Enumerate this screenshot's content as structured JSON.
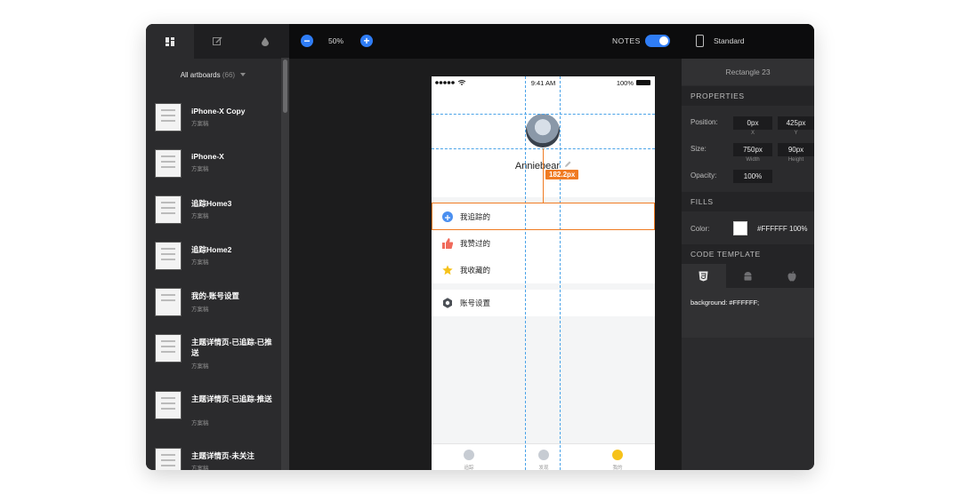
{
  "sidebar": {
    "tabs": [
      {
        "icon": "artboards-grid-icon",
        "active": true
      },
      {
        "icon": "edit-slice-icon",
        "active": false
      },
      {
        "icon": "color-drop-icon",
        "active": false
      }
    ],
    "filter_label": "All artboards",
    "filter_count": "(66)",
    "artboards": [
      {
        "name": "iPhone-X Copy",
        "sub": "方案稿"
      },
      {
        "name": "iPhone-X",
        "sub": "方案稿"
      },
      {
        "name": "追踪Home3",
        "sub": "方案稿"
      },
      {
        "name": "追踪Home2",
        "sub": "方案稿"
      },
      {
        "name": "我的-账号设置",
        "sub": "方案稿"
      },
      {
        "name": "主题详情页-已追踪-已推送",
        "sub": "方案稿"
      },
      {
        "name": "主题详情页-已追踪-推送",
        "sub": "方案稿"
      },
      {
        "name": "主题详情页-未关注",
        "sub": "方案稿"
      }
    ]
  },
  "toolbar": {
    "zoom_out": "−",
    "zoom_value": "50%",
    "zoom_in": "+",
    "notes_label": "NOTES",
    "notes_on": true
  },
  "phone": {
    "status_time": "9:41 AM",
    "status_battery": "100%",
    "username": "Anniebear",
    "measurement": "182.2px",
    "menu": [
      {
        "label": "我追踪的",
        "icon": "plus-circle-icon",
        "color": "#4a8ff0"
      },
      {
        "label": "我赞过的",
        "icon": "thumbs-up-icon",
        "color": "#f06a5b"
      },
      {
        "label": "我收藏的",
        "icon": "star-icon",
        "color": "#f6c21a"
      },
      {
        "label": "账号设置",
        "icon": "hexagon-gear-icon",
        "color": "#4b4f55"
      }
    ],
    "tabs": [
      {
        "label": "追踪",
        "color": "#c7ccd3"
      },
      {
        "label": "发现",
        "color": "#c7ccd3"
      },
      {
        "label": "我的",
        "color": "#f6c21a"
      }
    ]
  },
  "inspector": {
    "device": "Standard",
    "layer_name": "Rectangle 23",
    "properties_head": "PROPERTIES",
    "position_label": "Position:",
    "pos_x": "0px",
    "pos_y": "425px",
    "pos_x_cap": "X",
    "pos_y_cap": "Y",
    "size_label": "Size:",
    "width": "750px",
    "height": "90px",
    "width_cap": "Width",
    "height_cap": "Height",
    "opacity_label": "Opacity:",
    "opacity": "100%",
    "fills_head": "FILLS",
    "color_label": "Color:",
    "color_value": "#FFFFFF 100%",
    "code_head": "CODE TEMPLATE",
    "code_tabs": [
      "css3-icon",
      "android-icon",
      "apple-icon"
    ],
    "code_text": "background: #FFFFFF;"
  },
  "colors": {
    "accent": "#2f7df6",
    "measure": "#f07b22",
    "guide": "#4aa3e8"
  }
}
